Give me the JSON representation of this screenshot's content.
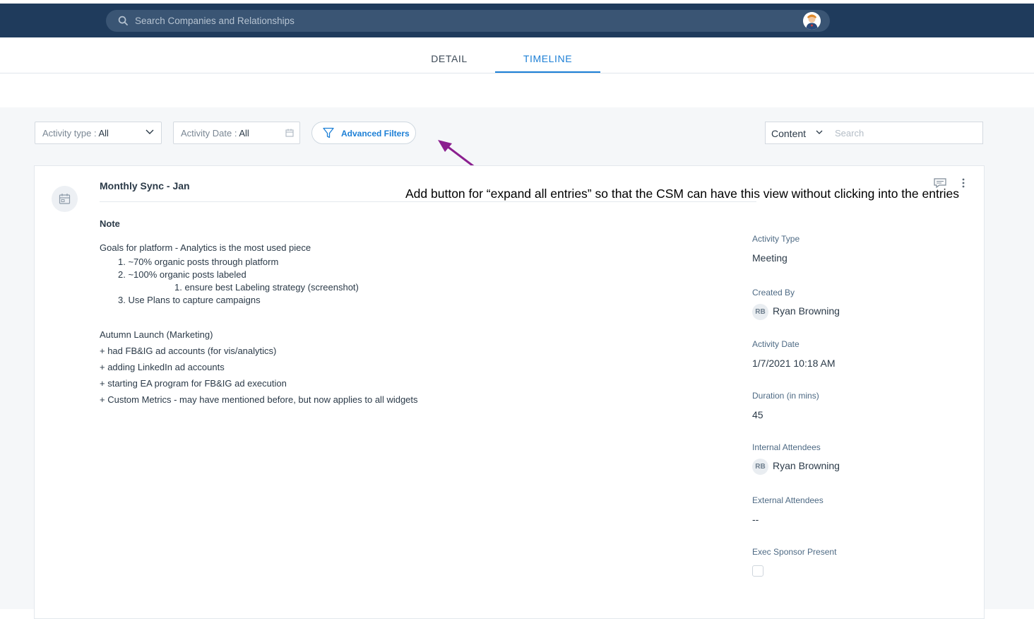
{
  "topbar": {
    "search_placeholder": "Search Companies and Relationships",
    "icon": "search-icon",
    "avatar_icon": "user-avatar-icon"
  },
  "tabs": [
    {
      "label": "DETAIL",
      "active": false
    },
    {
      "label": "TIMELINE",
      "active": true
    }
  ],
  "filters": {
    "activity_type_label": "Activity type : ",
    "activity_type_value": "All",
    "activity_date_label": "Activity Date : ",
    "activity_date_value": "All",
    "advanced_filters_label": "Advanced Filters",
    "content_select": "Content",
    "search_placeholder": "Search"
  },
  "entry": {
    "title": "Monthly Sync - Jan",
    "note_heading": "Note",
    "note_line_1": "Goals for platform - Analytics is the most used piece",
    "list_1": "1. ~70% organic posts through platform",
    "list_2": "2. ~100% organic posts labeled",
    "list_2_sub": "1. ensure best Labeling strategy (screenshot)",
    "list_3": "3. Use Plans to capture campaigns",
    "autumn": "Autumn Launch (Marketing)",
    "plus_1": "+ had FB&IG ad accounts (for vis/analytics)",
    "plus_2": "+ adding LinkedIn ad accounts",
    "plus_3": "+ starting EA program for FB&IG ad execution",
    "plus_4": "+ Custom Metrics - may have mentioned before, but now applies to all widgets"
  },
  "annotation": "Add button for “expand all entries” so that the CSM can have this view without clicking into the entries",
  "details": {
    "activity_type_label": "Activity Type",
    "activity_type_value": "Meeting",
    "created_by_label": "Created By",
    "created_by_initials": "RB",
    "created_by_name": "Ryan Browning",
    "activity_date_label": "Activity Date",
    "activity_date_value": "1/7/2021 10:18 AM",
    "duration_label": "Duration (in mins)",
    "duration_value": "45",
    "internal_label": "Internal Attendees",
    "internal_initials": "RB",
    "internal_name": "Ryan Browning",
    "external_label": "External Attendees",
    "external_value": "--",
    "exec_label": "Exec Sponsor Present",
    "exec_checked": false
  },
  "colors": {
    "topbar": "#1f3b5c",
    "accent": "#1c7fd6",
    "annotation_arrow": "#8b1f8f"
  }
}
